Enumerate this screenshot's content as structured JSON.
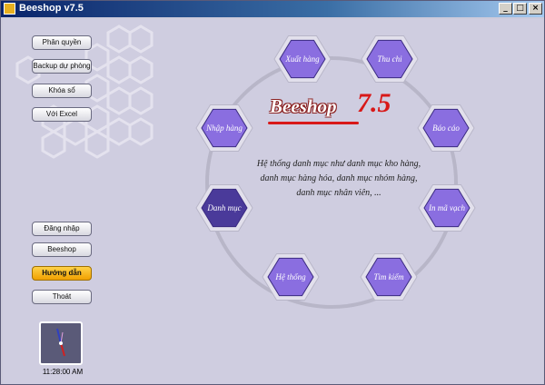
{
  "window": {
    "title": "Beeshop v7.5",
    "controls": {
      "minimize": "_",
      "maximize": "□",
      "close": "×"
    }
  },
  "sidebar": {
    "top_buttons": [
      {
        "label": "Phân quyền"
      },
      {
        "label": "Backup dự phòng"
      },
      {
        "label": "Khóa sổ"
      },
      {
        "label": "Với Excel"
      }
    ],
    "bottom_buttons": [
      {
        "label": "Đăng nhập"
      },
      {
        "label": "Beeshop"
      },
      {
        "label": "Hướng dẫn",
        "active": true
      },
      {
        "label": "Thoát"
      }
    ]
  },
  "clock": {
    "time": "11:28:00 AM"
  },
  "logo": {
    "brand": "Beeshop",
    "version": "7.5"
  },
  "menu": [
    {
      "id": "xuat-hang",
      "label": "Xuất hàng"
    },
    {
      "id": "thu-chi",
      "label": "Thu chi"
    },
    {
      "id": "bao-cao",
      "label": "Báo cáo"
    },
    {
      "id": "in-ma-vach",
      "label": "In mã vạch"
    },
    {
      "id": "tim-kiem",
      "label": "Tìm kiếm"
    },
    {
      "id": "he-thong",
      "label": "Hệ thống"
    },
    {
      "id": "danh-muc",
      "label": "Danh mục",
      "selected": true
    },
    {
      "id": "nhap-hang",
      "label": "Nhập hàng"
    }
  ],
  "description": "Hệ thống danh mục như danh mục kho hàng, danh mục hàng hóa, danh mục nhóm hàng, danh mục nhân viên, ...",
  "colors": {
    "hex_fill": "#8a6ee0",
    "hex_selected": "#4a3a9a",
    "accent_red": "#d81818",
    "active_button": "#f0a000"
  }
}
